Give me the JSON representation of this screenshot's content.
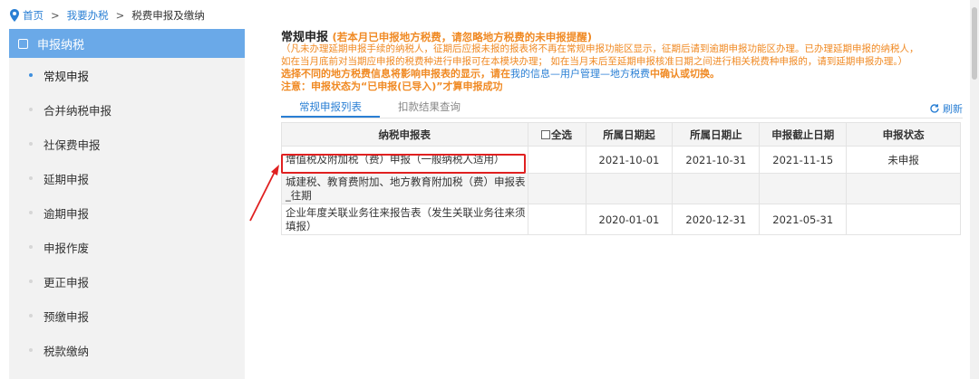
{
  "breadcrumb": {
    "home": "首页",
    "sep1": ">",
    "tax": "我要办税",
    "sep2": ">",
    "current": "税费申报及缴纳"
  },
  "sidebar": {
    "header": "申报纳税",
    "items": [
      {
        "label": "常规申报"
      },
      {
        "label": "合并纳税申报"
      },
      {
        "label": "社保费申报"
      },
      {
        "label": "延期申报"
      },
      {
        "label": "逾期申报"
      },
      {
        "label": "申报作废"
      },
      {
        "label": "更正申报"
      },
      {
        "label": "预缴申报"
      },
      {
        "label": "税款缴纳"
      }
    ]
  },
  "main": {
    "title": "常规申报",
    "title_warning": "(若本月已申报地方税费，请忽略地方税费的未申报提醒)",
    "notice_line1": "（凡未办理延期申报手续的纳税人，征期后应报未报的报表将不再在常规申报功能区显示，征期后请到逾期申报功能区办理。已办理延期申报的纳税人，",
    "notice_line2": "如在当月底前对当期应申报的税费种进行申报可在本模块办理； 如在当月末后至延期申报核准日期之间进行相关税费种申报的，请到延期申报办理。）",
    "notice_bold_a": "选择不同的地方税费信息将影响申报表的显示，请在",
    "notice_bold_link": "我的信息—用户管理—地方税费",
    "notice_bold_b": "中确认或切换。",
    "notice_status": "注意：申报状态为“已申报(已导入)”才算申报成功",
    "tabs": [
      "常规申报列表",
      "扣款结果查询"
    ],
    "refresh": "刷新"
  },
  "table": {
    "headers": {
      "name": "纳税申报表",
      "select_all": "全选",
      "start": "所属日期起",
      "end": "所属日期止",
      "deadline": "申报截止日期",
      "status": "申报状态"
    },
    "rows": [
      {
        "name": "增值税及附加税（费）申报（一般纳税人适用）",
        "start": "2021-10-01",
        "end": "2021-10-31",
        "deadline": "2021-11-15",
        "status": "未申报"
      },
      {
        "name": "城建税、教育费附加、地方教育附加税（费）申报表_往期",
        "start": "",
        "end": "",
        "deadline": "",
        "status": ""
      },
      {
        "name": "企业年度关联业务往来报告表（发生关联业务往来须填报）",
        "start": "2020-01-01",
        "end": "2020-12-31",
        "deadline": "2021-05-31",
        "status": ""
      }
    ]
  },
  "colors": {
    "accent": "#2a7fd4",
    "sidebar_header": "#6aa9e8",
    "warning": "#f08a24",
    "highlight": "#e02020"
  }
}
